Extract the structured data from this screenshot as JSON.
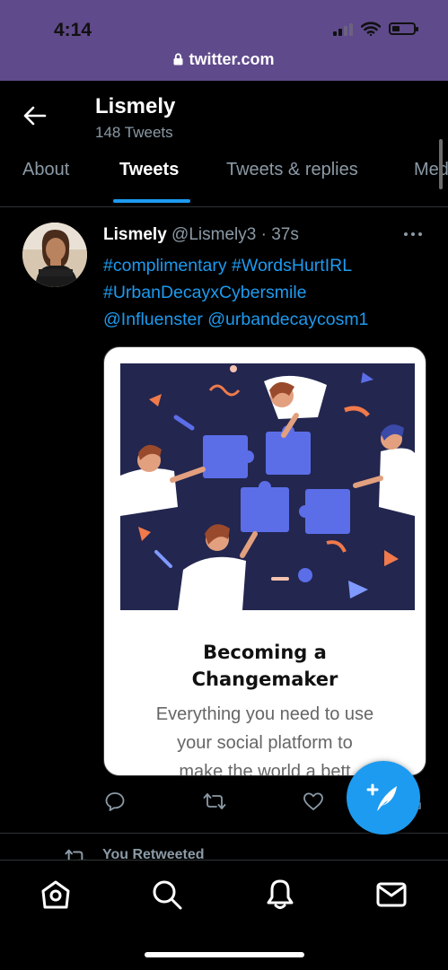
{
  "status_bar": {
    "time": "4:14",
    "url": "twitter.com",
    "signal_bars_lit": 2,
    "signal_bars_total": 4,
    "battery_level": 0.3,
    "background_color": "#5f4a8b"
  },
  "header": {
    "back_icon": "arrow-left-icon",
    "name": "Lismely",
    "tweet_count": "148 Tweets"
  },
  "tabs": [
    {
      "label": "About",
      "active": false
    },
    {
      "label": "Tweets",
      "active": true
    },
    {
      "label": "Tweets & replies",
      "active": false
    },
    {
      "label": "Media",
      "active": false
    }
  ],
  "tweet": {
    "author_name": "Lismely",
    "author_meta": "@Lismely3 · 37s",
    "text_lines": [
      "#complimentary #WordsHurtIRL",
      "#UrbanDecayxCybersmile",
      "@Influenster @urbandecaycosm1"
    ],
    "card": {
      "title_line1": "Becoming a",
      "title_line2": "Changemaker",
      "desc_line1": "Everything you need to use",
      "desc_line2": "your social platform to",
      "desc_line3": "make the world a bett"
    },
    "actions": [
      "reply-icon",
      "retweet-icon",
      "like-icon",
      "share-icon"
    ]
  },
  "retweet_notice": "You Retweeted",
  "bottom_nav": [
    "home-icon",
    "search-icon",
    "notifications-icon",
    "messages-icon"
  ],
  "colors": {
    "accent": "#1d9bf0",
    "background": "#000000",
    "secondary_text": "#8b9aa6",
    "divider": "#2f3336"
  }
}
